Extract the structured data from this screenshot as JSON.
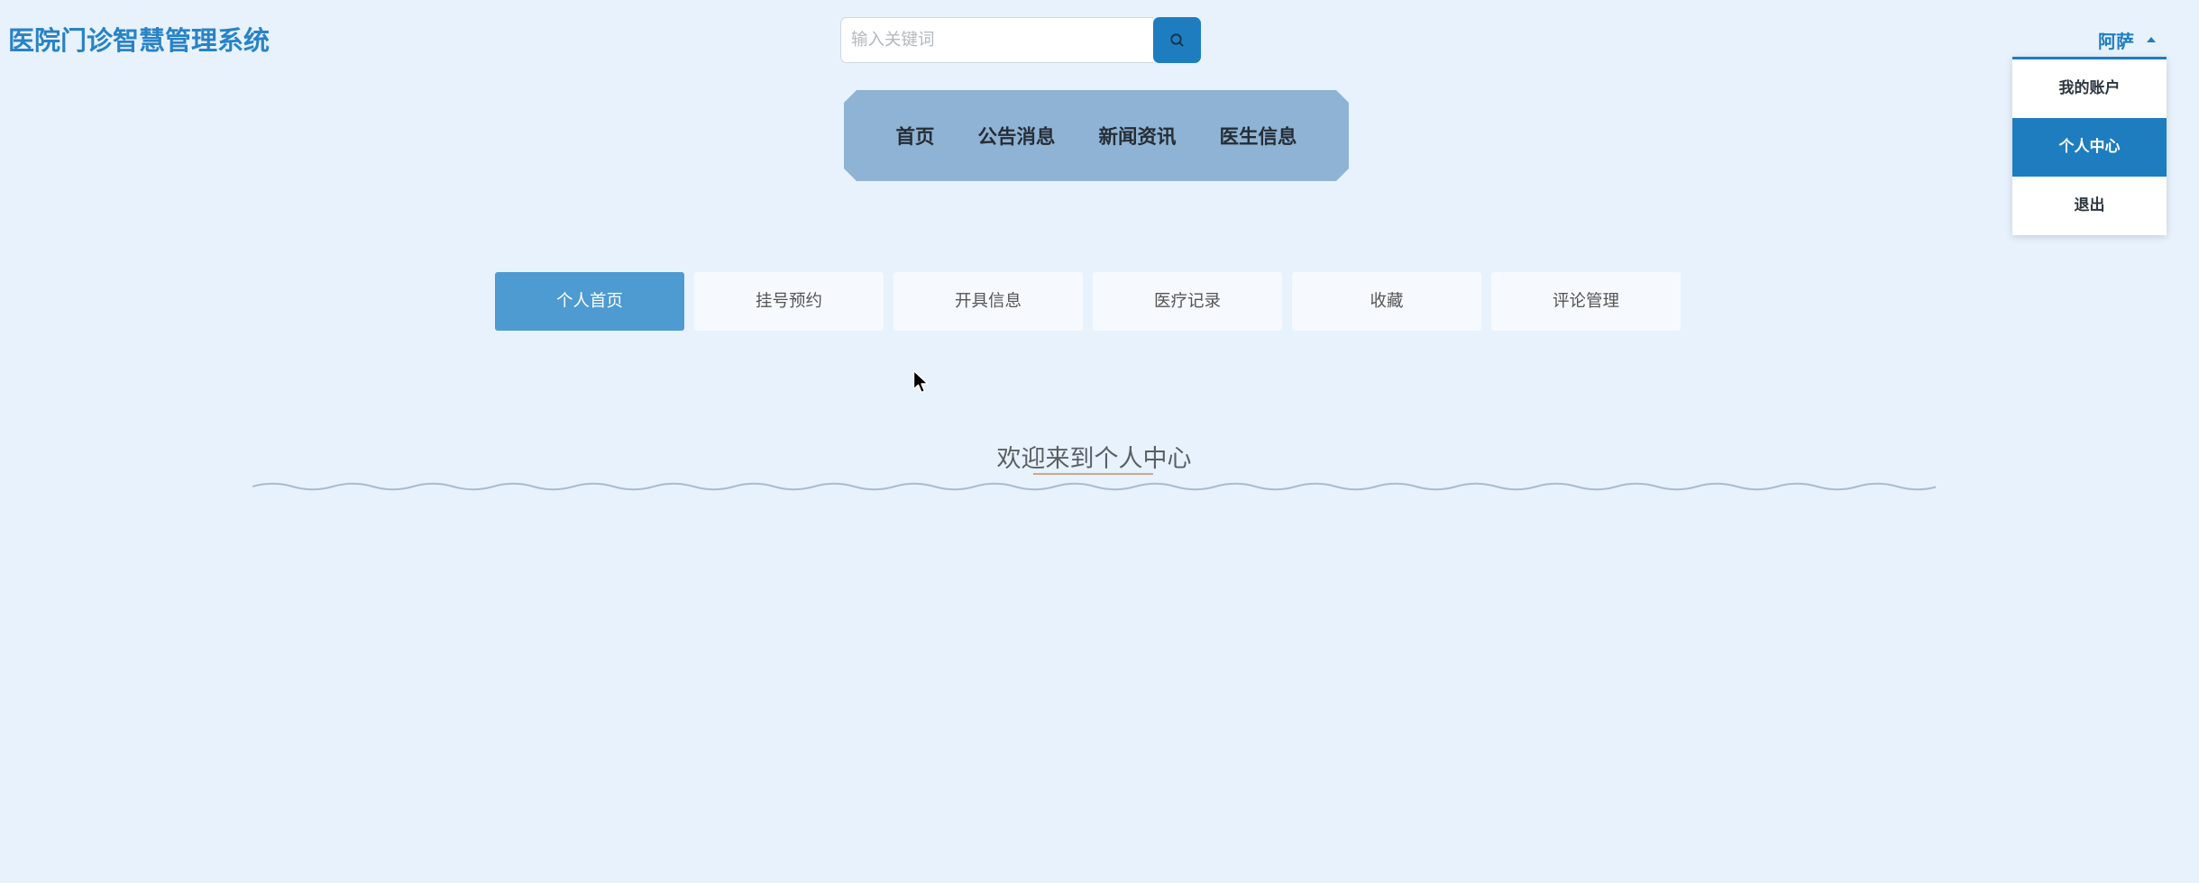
{
  "app": {
    "title": "医院门诊智慧管理系统"
  },
  "search": {
    "placeholder": "输入关键词",
    "value": "",
    "button_icon": "search-icon"
  },
  "nav": {
    "items": [
      {
        "label": "首页"
      },
      {
        "label": "公告消息"
      },
      {
        "label": "新闻资讯"
      },
      {
        "label": "医生信息"
      }
    ]
  },
  "user": {
    "name": "阿萨",
    "caret_icon": "caret-up-icon",
    "menu_open": true,
    "menu": [
      {
        "label": "我的账户",
        "active": false
      },
      {
        "label": "个人中心",
        "active": true
      },
      {
        "label": "退出",
        "active": false
      }
    ]
  },
  "tabs": [
    {
      "label": "个人首页",
      "active": true
    },
    {
      "label": "挂号预约",
      "active": false
    },
    {
      "label": "开具信息",
      "active": false
    },
    {
      "label": "医疗记录",
      "active": false
    },
    {
      "label": "收藏",
      "active": false
    },
    {
      "label": "评论管理",
      "active": false
    }
  ],
  "welcome": {
    "text": "欢迎来到个人中心"
  },
  "pointer": {
    "icon": "mouse-pointer-icon"
  },
  "colors": {
    "bg": "#e8f2fc",
    "brand": "#2883c6",
    "accent": "#1e7dbf",
    "nav_bg": "#8fb3d4",
    "tab_active": "#4d9bd1",
    "tab_bg": "#f6faff",
    "wave": "#a9bccd"
  }
}
